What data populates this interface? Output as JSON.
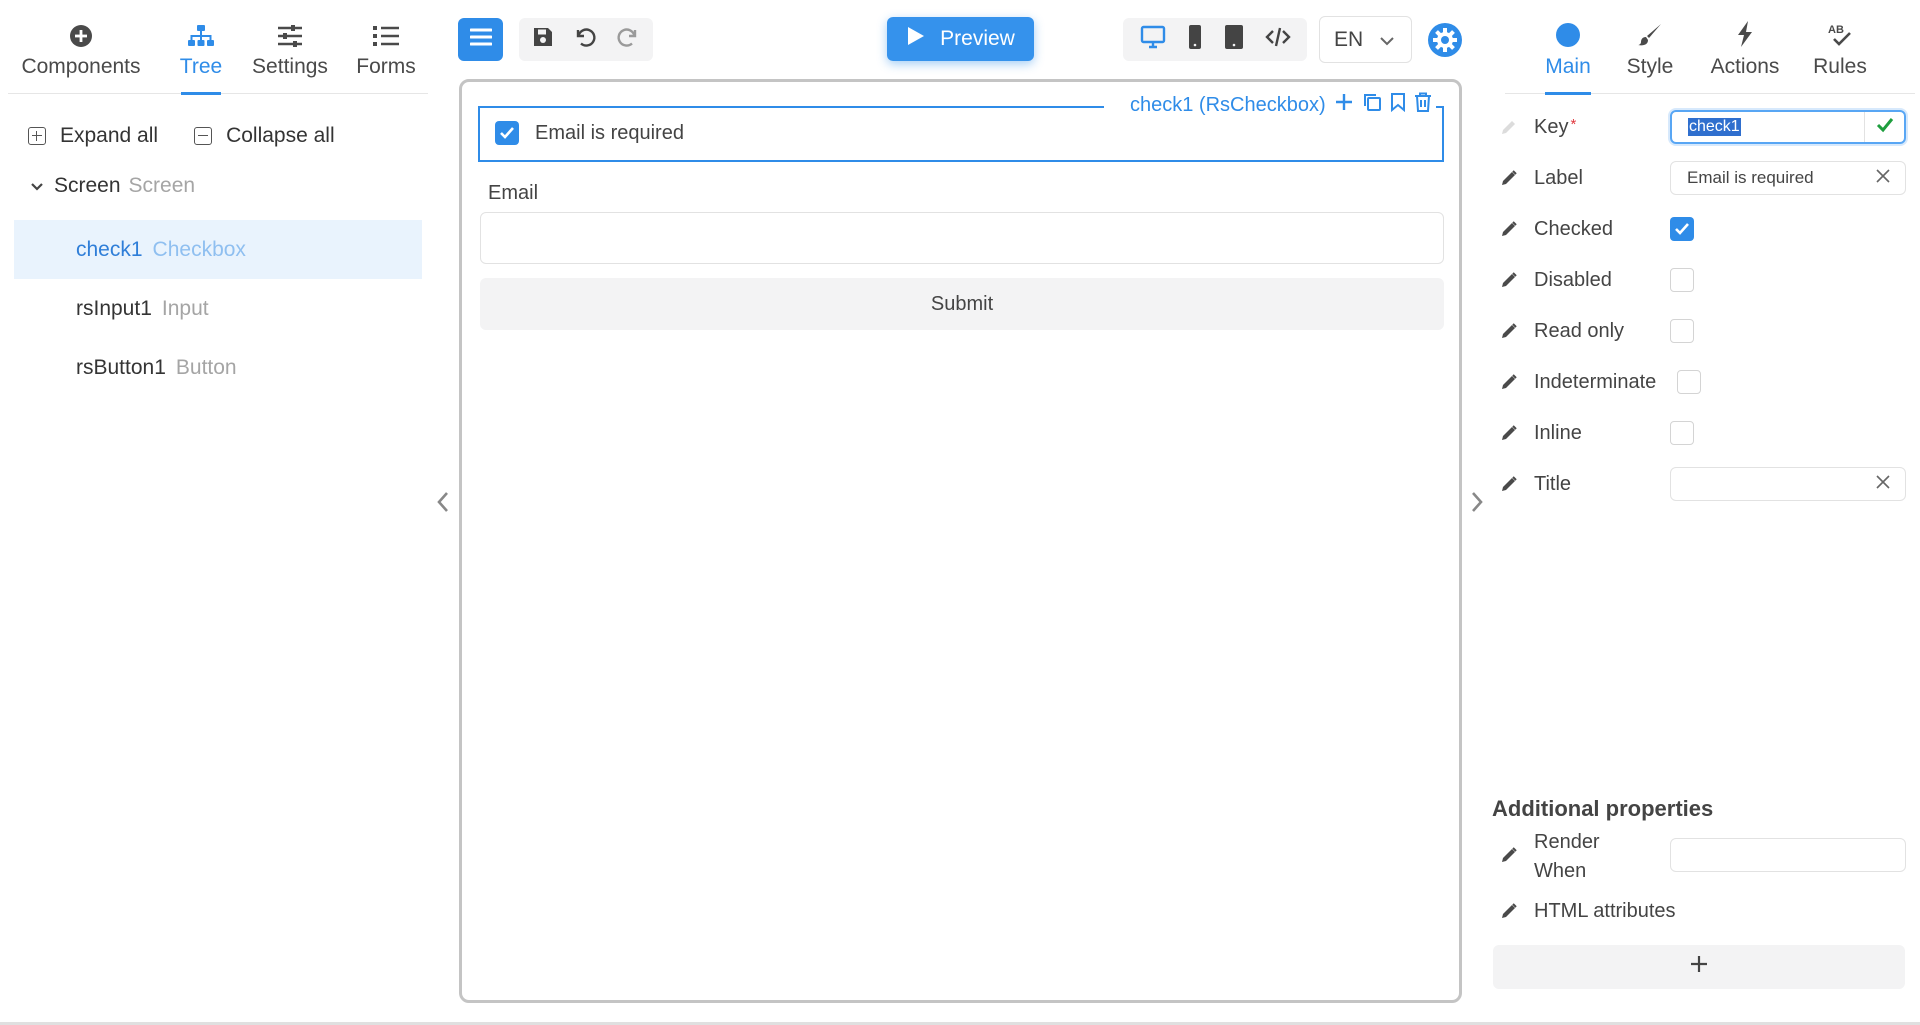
{
  "left_tabs": [
    {
      "label": "Components",
      "icon": "plus-circle-icon"
    },
    {
      "label": "Tree",
      "icon": "sitemap-icon"
    },
    {
      "label": "Settings",
      "icon": "sliders-icon"
    },
    {
      "label": "Forms",
      "icon": "list-icon"
    }
  ],
  "tree": {
    "expand_all": "Expand all",
    "collapse_all": "Collapse all",
    "root": {
      "name": "Screen",
      "type": "Screen"
    },
    "items": [
      {
        "name": "check1",
        "type": "Checkbox",
        "selected": true
      },
      {
        "name": "rsInput1",
        "type": "Input",
        "selected": false
      },
      {
        "name": "rsButton1",
        "type": "Button",
        "selected": false
      }
    ]
  },
  "toolbar": {
    "preview_label": "Preview",
    "language": "EN"
  },
  "canvas": {
    "selected_component": "check1 (RsCheckbox)",
    "checkbox_label": "Email is required",
    "email_label": "Email",
    "submit_label": "Submit"
  },
  "right_tabs": [
    {
      "label": "Main",
      "icon": "circle-icon"
    },
    {
      "label": "Style",
      "icon": "brush-icon"
    },
    {
      "label": "Actions",
      "icon": "bolt-icon"
    },
    {
      "label": "Rules",
      "icon": "spellcheck-icon"
    }
  ],
  "props": {
    "key_label": "Key",
    "key_required_mark": "*",
    "key_value": "check1",
    "label_label": "Label",
    "label_value": "Email is required",
    "checked_label": "Checked",
    "disabled_label": "Disabled",
    "readonly_label": "Read only",
    "indeterminate_label": "Indeterminate",
    "inline_label": "Inline",
    "title_label": "Title",
    "title_value": "",
    "checked": true,
    "disabled": false,
    "readonly": false,
    "indeterminate": false,
    "inline": false
  },
  "additional": {
    "title": "Additional properties",
    "render_when_line1": "Render",
    "render_when_line2": "When",
    "render_when_value": "",
    "html_attributes": "HTML attributes"
  },
  "colors": {
    "accent": "#2f8ce8",
    "selected_bg": "#e9f3fd",
    "muted_text": "#a5a5a5",
    "ok_check": "#1e9e3e"
  }
}
